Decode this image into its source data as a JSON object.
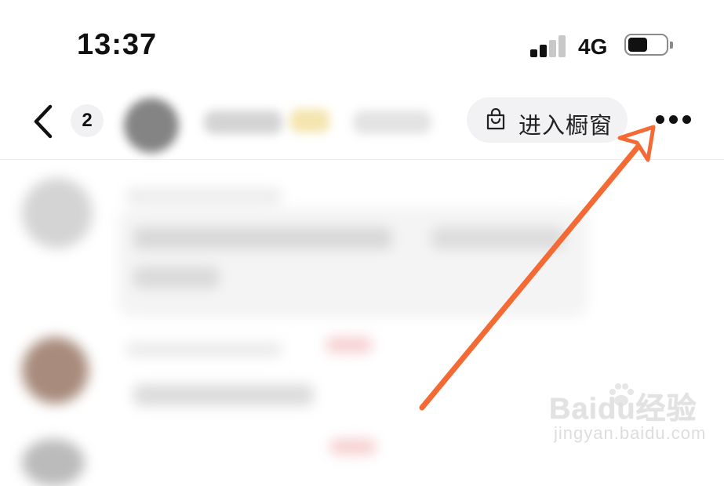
{
  "status_bar": {
    "time": "13:37",
    "network": "4G",
    "signal_bars": 4,
    "signal_active_bars": 2,
    "battery_level": 0.45,
    "icons": [
      "signal-icon",
      "battery-icon"
    ]
  },
  "nav_bar": {
    "back_icon": "chevron-left-icon",
    "unread_count": "2",
    "shop_button": {
      "label": "进入橱窗",
      "icon": "shopping-bag-icon"
    },
    "more_icon": "more-dots-icon"
  },
  "annotation": {
    "arrow_color": "#f46a34"
  },
  "watermark": {
    "brand": "Baidu经验",
    "url": "jingyan.baidu.com"
  },
  "colors": {
    "button_bg": "#f2f2f4",
    "text": "#111111",
    "divider": "#ececec"
  }
}
